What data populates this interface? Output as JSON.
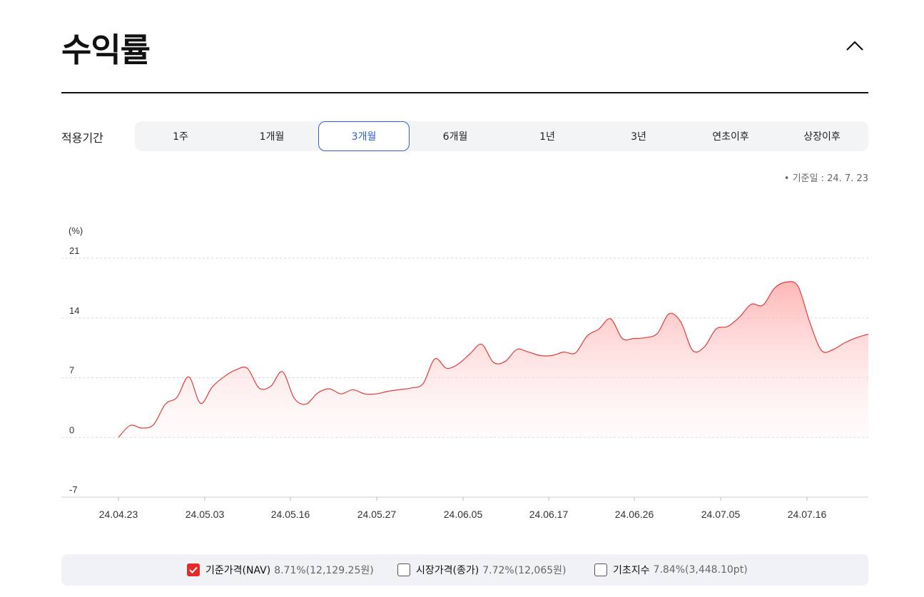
{
  "header": {
    "title": "수익률",
    "collapse_icon": "chevron-up-icon"
  },
  "period": {
    "label": "적용기간",
    "tabs": [
      "1주",
      "1개월",
      "3개월",
      "6개월",
      "1년",
      "3년",
      "연초이후",
      "상장이후"
    ],
    "active_index": 2
  },
  "base_date": "• 기준일 : 24. 7. 23",
  "colors": {
    "accent": "#2f5fd1",
    "series_line": "#e23b3b",
    "series_fill": "#ffb3b3",
    "checkbox_on": "#e52a2a"
  },
  "chart_data": {
    "type": "area",
    "unit_label": "(%)",
    "ylim": [
      -7,
      21
    ],
    "yticks": [
      "21",
      "14",
      "7",
      "0",
      "-7"
    ],
    "ytick_values": [
      21,
      14,
      7,
      0,
      -7
    ],
    "xtick_labels": [
      "24.04.23",
      "24.05.03",
      "24.05.16",
      "24.05.27",
      "24.06.05",
      "24.06.17",
      "24.06.26",
      "24.07.05",
      "24.07.16"
    ],
    "grid": true,
    "series": [
      {
        "name": "기준가격(NAV)",
        "x_index": [
          0,
          1,
          2,
          3,
          4,
          5,
          6,
          7,
          8,
          9,
          10,
          11,
          12,
          13,
          14,
          15,
          16,
          17,
          18,
          19,
          20,
          21,
          22,
          23,
          24,
          25,
          26,
          27,
          28,
          29,
          30,
          31,
          32,
          33,
          34,
          35,
          36,
          37,
          38,
          39,
          40,
          41,
          42,
          43,
          44,
          45,
          46,
          47,
          48,
          49,
          50,
          51,
          52,
          53,
          54,
          55,
          56,
          57,
          58,
          59,
          60,
          61,
          62,
          63,
          64
        ],
        "values": [
          0,
          1.4,
          1.1,
          1.5,
          3.9,
          4.7,
          7.1,
          4.0,
          5.9,
          7.1,
          7.9,
          8.1,
          5.8,
          6.0,
          7.7,
          4.6,
          3.9,
          5.2,
          5.7,
          5.1,
          5.6,
          5.1,
          5.1,
          5.4,
          5.6,
          5.8,
          6.3,
          9.2,
          8.1,
          8.6,
          9.8,
          10.9,
          8.8,
          8.9,
          10.3,
          10.0,
          9.6,
          9.6,
          10.0,
          9.9,
          11.9,
          12.7,
          13.9,
          11.6,
          11.6,
          11.7,
          12.2,
          14.5,
          13.5,
          10.2,
          10.6,
          12.7,
          13.0,
          14.1,
          15.6,
          15.5,
          17.5,
          18.2,
          17.7,
          13.5,
          10.2,
          10.3,
          11.1,
          11.7,
          12.1
        ]
      }
    ]
  },
  "legend": [
    {
      "name": "기준가격(NAV)",
      "value": "8.71%(12,129.25원)",
      "checked": true
    },
    {
      "name": "시장가격(종가)",
      "value": "7.72%(12,065원)",
      "checked": false
    },
    {
      "name": "기초지수",
      "value": "7.84%(3,448.10pt)",
      "checked": false
    }
  ]
}
